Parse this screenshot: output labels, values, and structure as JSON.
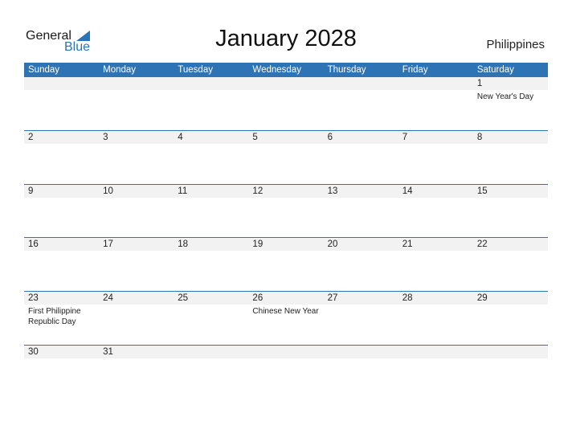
{
  "brand": {
    "line1": "General",
    "line2": "Blue",
    "accent": "#2e74b5"
  },
  "title": "January 2028",
  "country": "Philippines",
  "weekdays": [
    "Sunday",
    "Monday",
    "Tuesday",
    "Wednesday",
    "Thursday",
    "Friday",
    "Saturday"
  ],
  "weeks": [
    [
      {
        "d": ""
      },
      {
        "d": ""
      },
      {
        "d": ""
      },
      {
        "d": ""
      },
      {
        "d": ""
      },
      {
        "d": ""
      },
      {
        "d": "1",
        "event": "New Year's Day"
      }
    ],
    [
      {
        "d": "2"
      },
      {
        "d": "3"
      },
      {
        "d": "4"
      },
      {
        "d": "5"
      },
      {
        "d": "6"
      },
      {
        "d": "7"
      },
      {
        "d": "8"
      }
    ],
    [
      {
        "d": "9"
      },
      {
        "d": "10"
      },
      {
        "d": "11"
      },
      {
        "d": "12"
      },
      {
        "d": "13"
      },
      {
        "d": "14"
      },
      {
        "d": "15"
      }
    ],
    [
      {
        "d": "16"
      },
      {
        "d": "17"
      },
      {
        "d": "18"
      },
      {
        "d": "19"
      },
      {
        "d": "20"
      },
      {
        "d": "21"
      },
      {
        "d": "22"
      }
    ],
    [
      {
        "d": "23",
        "event": "First Philippine Republic Day"
      },
      {
        "d": "24"
      },
      {
        "d": "25"
      },
      {
        "d": "26",
        "event": "Chinese New Year"
      },
      {
        "d": "27"
      },
      {
        "d": "28"
      },
      {
        "d": "29"
      }
    ],
    [
      {
        "d": "30"
      },
      {
        "d": "31"
      },
      {
        "d": ""
      },
      {
        "d": ""
      },
      {
        "d": ""
      },
      {
        "d": ""
      },
      {
        "d": ""
      }
    ]
  ]
}
